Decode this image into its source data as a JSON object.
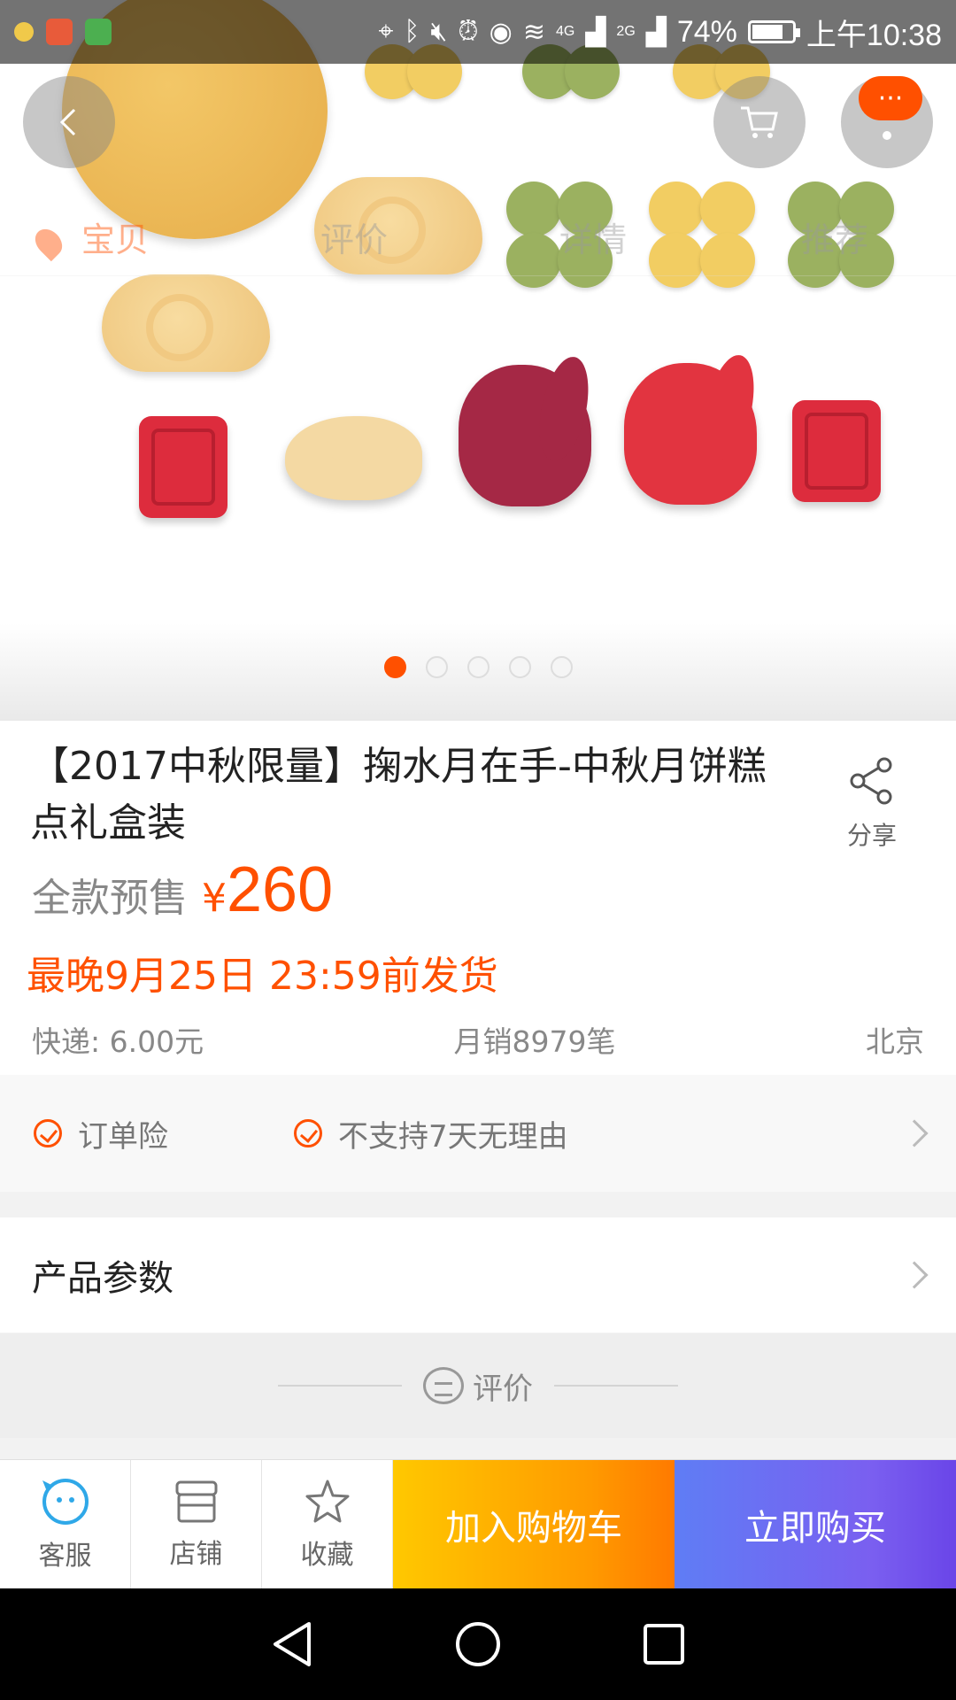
{
  "status_bar": {
    "battery": "74%",
    "time": "上午10:38",
    "network_4g": "4G",
    "network_2g": "2G"
  },
  "detail_tabs": [
    "宝贝",
    "评价",
    "详情",
    "推荐"
  ],
  "message_badge": "···",
  "carousel": {
    "total": 5,
    "active_index": 0
  },
  "product": {
    "title": "【2017中秋限量】掬水月在手-中秋月饼糕点礼盒装",
    "share_label": "分享",
    "presale_label": "全款预售",
    "currency": "¥",
    "price": "260",
    "ship_deadline": "最晚9月25日 23:59前发货",
    "shipping_fee": "快递: 6.00元",
    "monthly_sales": "月销8979笔",
    "location": "北京"
  },
  "guarantees": [
    "订单险",
    "不支持7天无理由"
  ],
  "params_label": "产品参数",
  "review_label": "评价",
  "action_bar": {
    "service": "客服",
    "shop": "店铺",
    "favorite": "收藏",
    "add_to_cart": "加入购物车",
    "buy_now": "立即购买"
  },
  "colors": {
    "accent": "#ff5000",
    "cart_gradient": [
      "#ffc800",
      "#ff7a00"
    ],
    "buy_gradient": [
      "#5f7df5",
      "#6a45e8"
    ]
  },
  "icons": [
    "back-icon",
    "cart-icon",
    "more-icon",
    "location-pin-icon",
    "share-icon",
    "check-circle-icon",
    "chevron-right-icon",
    "chat-bubble-icon",
    "customer-service-icon",
    "shop-icon",
    "star-icon"
  ]
}
